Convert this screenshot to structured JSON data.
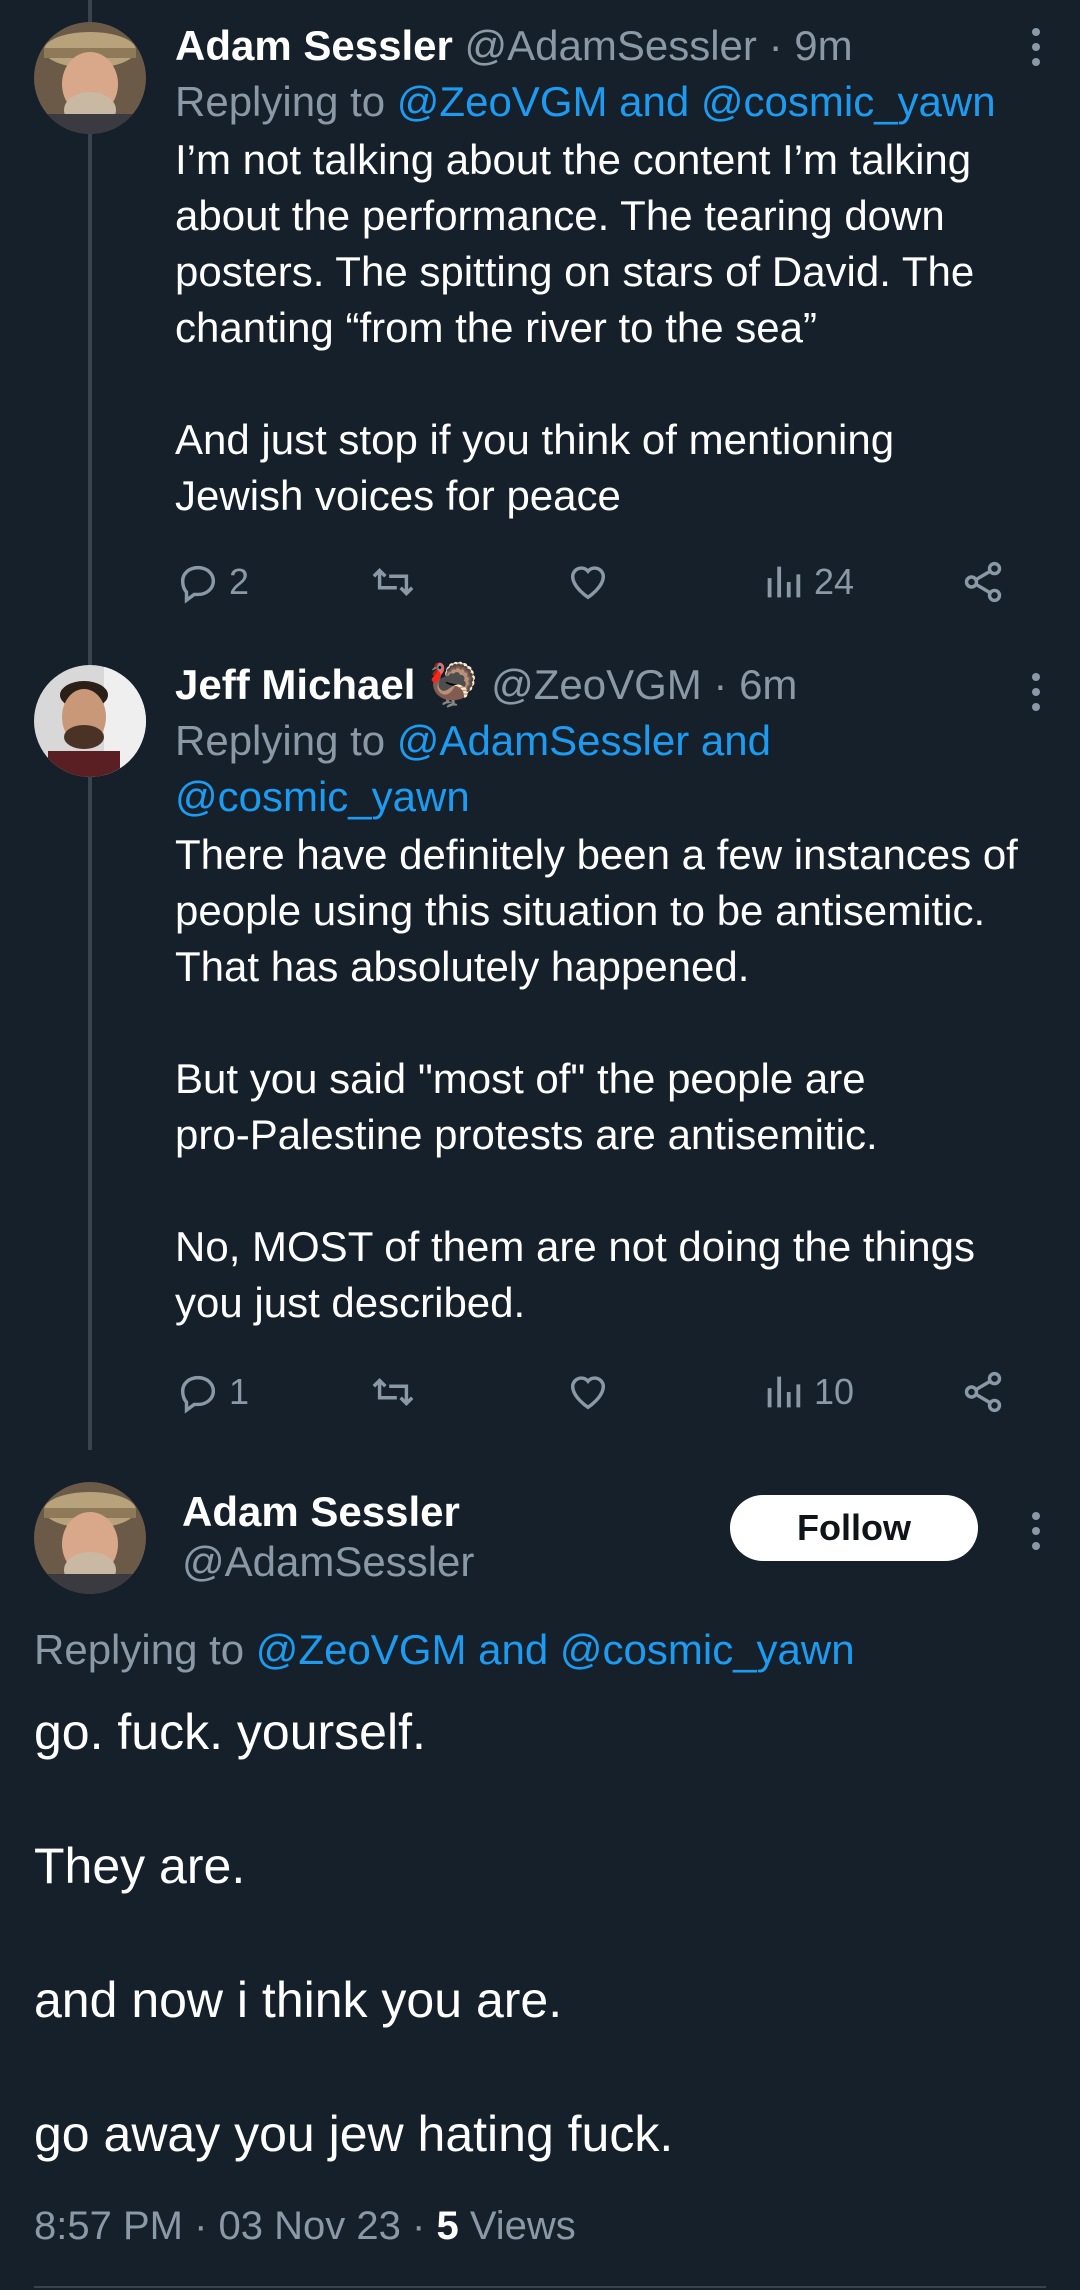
{
  "tweets": [
    {
      "name": "Adam Sessler",
      "handle": "@AdamSessler",
      "time": "· 9m",
      "replying_prefix": "Replying to",
      "replying_to": "@ZeoVGM and @cosmic_yawn",
      "lines": [
        "I’m not talking about the content I’m talking",
        "about the performance. The tearing down",
        "posters. The spitting on stars of David. The",
        "chanting “from the river to the sea”",
        "",
        "And just stop if you think of mentioning",
        "Jewish voices for peace"
      ],
      "replies": "2",
      "retweets": "",
      "likes": "",
      "views": "24"
    },
    {
      "name": "Jeff Michael",
      "emoji": "🦃",
      "handle": "@ZeoVGM",
      "time": "· 6m",
      "replying_prefix": "Replying to",
      "replying_to_line1": "@AdamSessler and",
      "replying_to_line2": "@cosmic_yawn",
      "lines": [
        "There have definitely been a few instances of",
        "people using this situation to be antisemitic.",
        "That has absolutely happened.",
        "",
        "But you said \"most of\" the people are",
        "pro-Palestine protests are antisemitic.",
        "",
        "No, MOST of them are not doing the things",
        "you just described."
      ],
      "replies": "1",
      "retweets": "",
      "likes": "",
      "views": "10"
    }
  ],
  "main_tweet": {
    "name": "Adam Sessler",
    "handle": "@AdamSessler",
    "follow_label": "Follow",
    "replying_prefix": "Replying to",
    "replying_to": "@ZeoVGM and @cosmic_yawn",
    "lines": [
      "go. fuck. yourself.",
      "",
      "They are.",
      "",
      "and now i think you are.",
      "",
      "go away you jew hating fuck."
    ],
    "time": "8:57 PM",
    "date": "03 Nov 23",
    "views_count": "5",
    "views_label": "Views"
  },
  "colors": {
    "background": "#15202b",
    "link": "#1d9bf0",
    "muted": "#8b98a5"
  }
}
